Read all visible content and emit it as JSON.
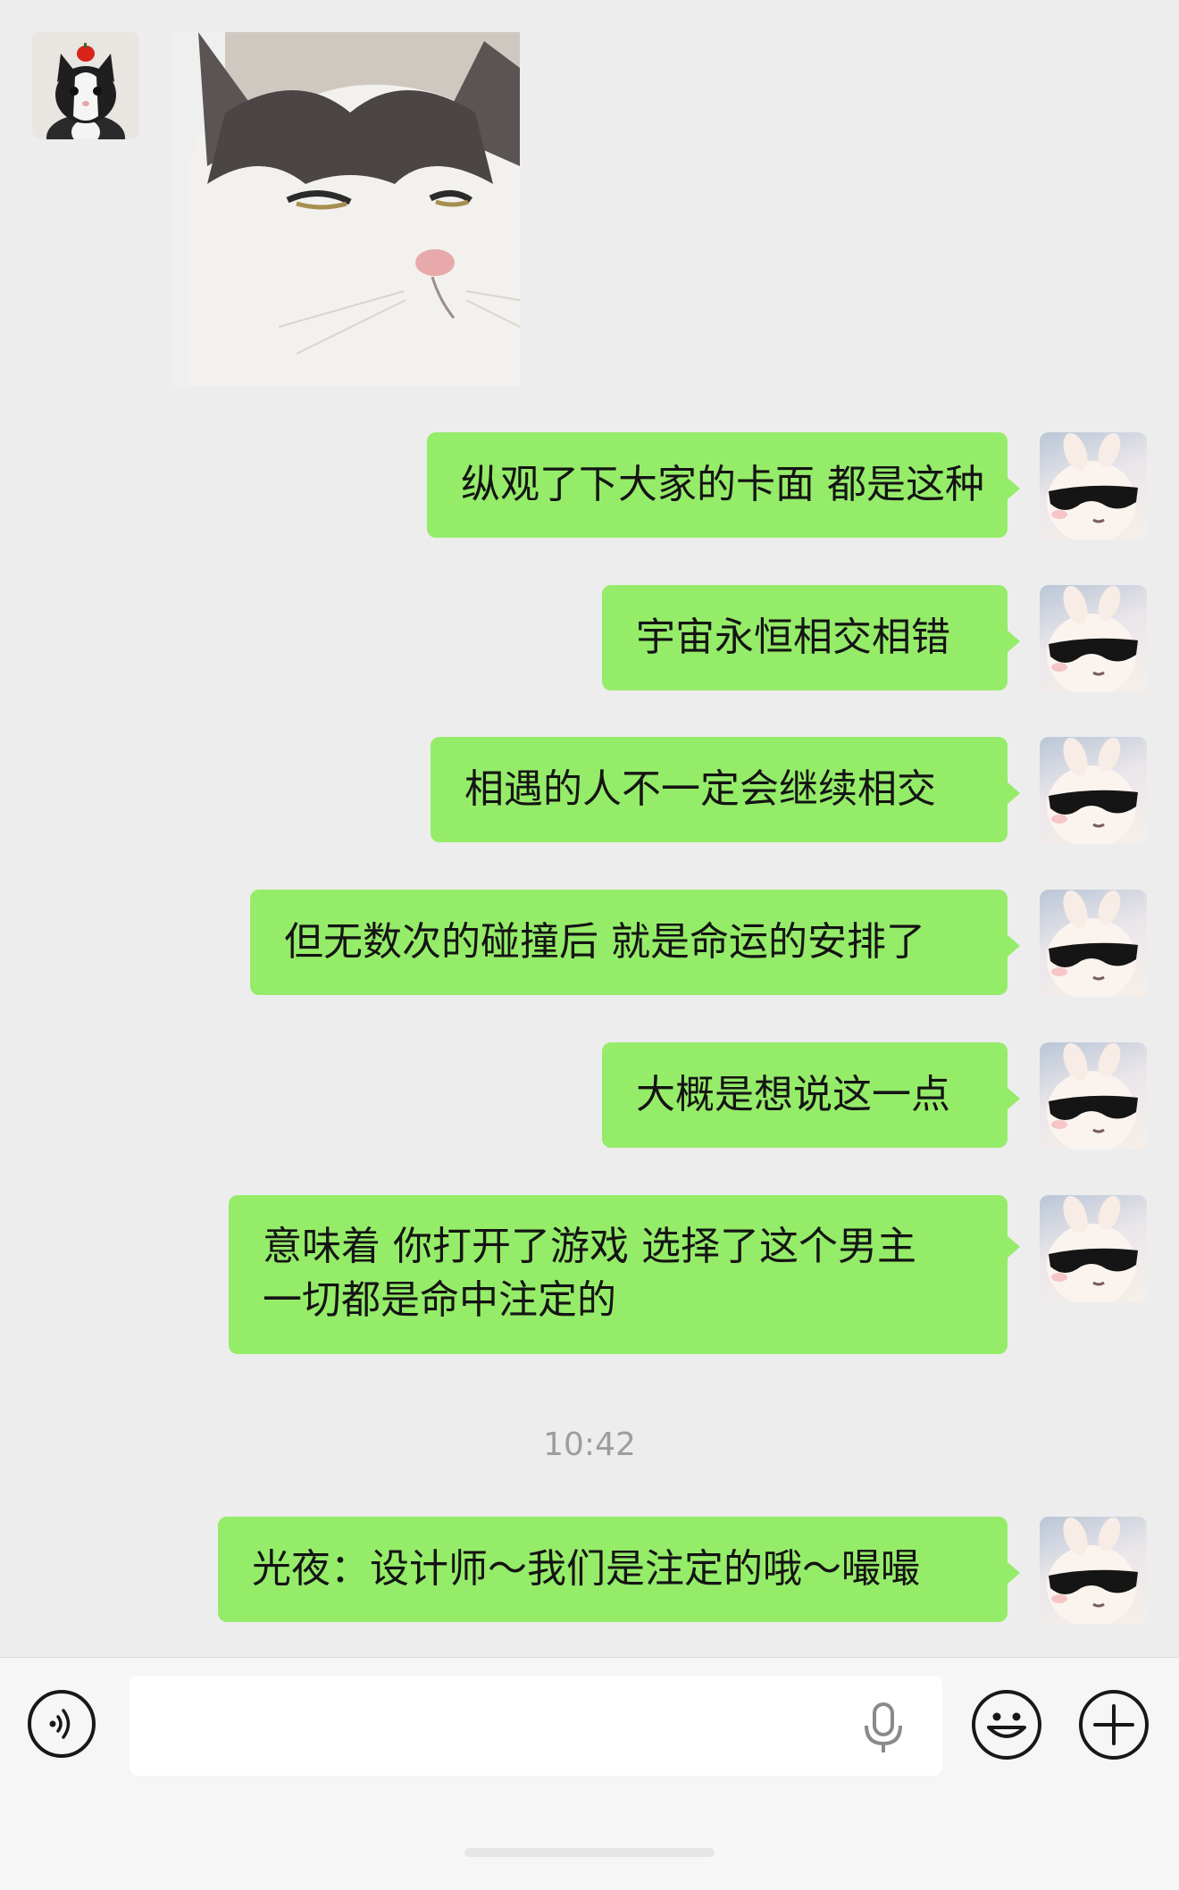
{
  "conversation": {
    "incoming": [
      {
        "type": "image",
        "avatar": "cat-avatar",
        "image": "grumpy-cat-sticker"
      }
    ],
    "outgoing": [
      {
        "text": "纵观了下大家的卡面 都是这种"
      },
      {
        "text": "宇宙永恒相交相错"
      },
      {
        "text": "相遇的人不一定会继续相交"
      },
      {
        "text": "但无数次的碰撞后 就是命运的安排了"
      },
      {
        "text": "大概是想说这一点"
      },
      {
        "line1": "意味着 你打开了游戏 选择了这个男主",
        "line2": "一切都是命中注定的"
      }
    ],
    "timestamp": "10:42",
    "after_timestamp": [
      {
        "text": "光夜：设计师～我们是注定的哦～嘬嘬"
      }
    ]
  },
  "input_bar": {
    "placeholder": "",
    "icons": [
      "voice-icon",
      "microphone-icon",
      "emoji-icon",
      "plus-icon"
    ]
  },
  "colors": {
    "background": "#ededed",
    "outgoing_bubble": "#95ec69",
    "timestamp_text": "#9d9d9d",
    "input_bar": "#f6f6f6"
  }
}
